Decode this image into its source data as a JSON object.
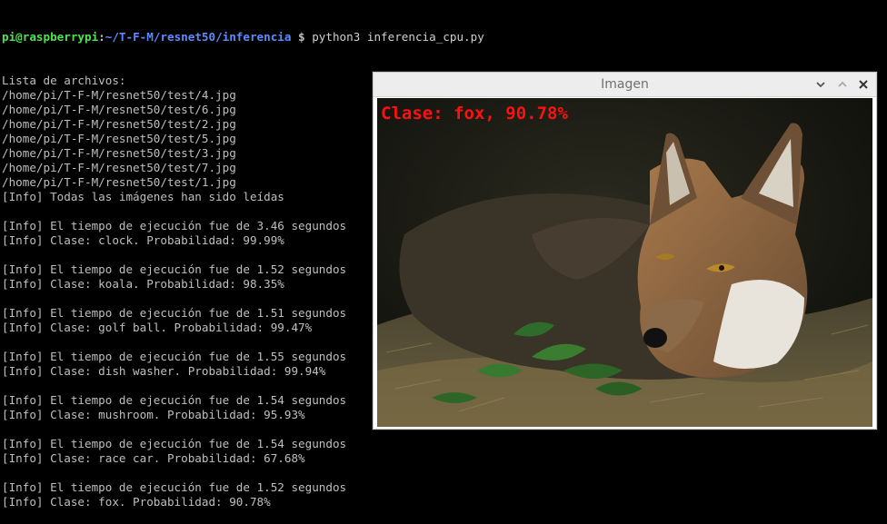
{
  "terminal": {
    "prompt": {
      "user_host": "pi@raspberrypi",
      "separator": ":",
      "path": "~/T-F-M/resnet50/inferencia",
      "symbol": " $ ",
      "command": "python3 inferencia_cpu.py"
    },
    "lines": [
      "Lista de archivos:",
      "/home/pi/T-F-M/resnet50/test/4.jpg",
      "/home/pi/T-F-M/resnet50/test/6.jpg",
      "/home/pi/T-F-M/resnet50/test/2.jpg",
      "/home/pi/T-F-M/resnet50/test/5.jpg",
      "/home/pi/T-F-M/resnet50/test/3.jpg",
      "/home/pi/T-F-M/resnet50/test/7.jpg",
      "/home/pi/T-F-M/resnet50/test/1.jpg",
      "[Info] Todas las imágenes han sido leídas",
      "",
      "[Info] El tiempo de ejecución fue de 3.46 segundos",
      "[Info] Clase: clock. Probabilidad: 99.99%",
      "",
      "[Info] El tiempo de ejecución fue de 1.52 segundos",
      "[Info] Clase: koala. Probabilidad: 98.35%",
      "",
      "[Info] El tiempo de ejecución fue de 1.51 segundos",
      "[Info] Clase: golf ball. Probabilidad: 99.47%",
      "",
      "[Info] El tiempo de ejecución fue de 1.55 segundos",
      "[Info] Clase: dish washer. Probabilidad: 99.94%",
      "",
      "[Info] El tiempo de ejecución fue de 1.54 segundos",
      "[Info] Clase: mushroom. Probabilidad: 95.93%",
      "",
      "[Info] El tiempo de ejecución fue de 1.54 segundos",
      "[Info] Clase: race car. Probabilidad: 67.68%",
      "",
      "[Info] El tiempo de ejecución fue de 1.52 segundos",
      "[Info] Clase: fox. Probabilidad: 90.78%"
    ]
  },
  "window": {
    "title": "Imagen",
    "overlay_label": "Clase: fox, 90.78%",
    "buttons": {
      "minimize_icon": "chevron-down-icon",
      "maximize_icon": "chevron-up-icon",
      "close_icon": "close-icon"
    }
  },
  "colors": {
    "terminal_bg": "#000000",
    "terminal_text": "#bfbfbf",
    "prompt_user": "#4ee44e",
    "prompt_path": "#5b8cff",
    "overlay_red": "#ff1010",
    "titlebar_bg": "#ededed"
  }
}
